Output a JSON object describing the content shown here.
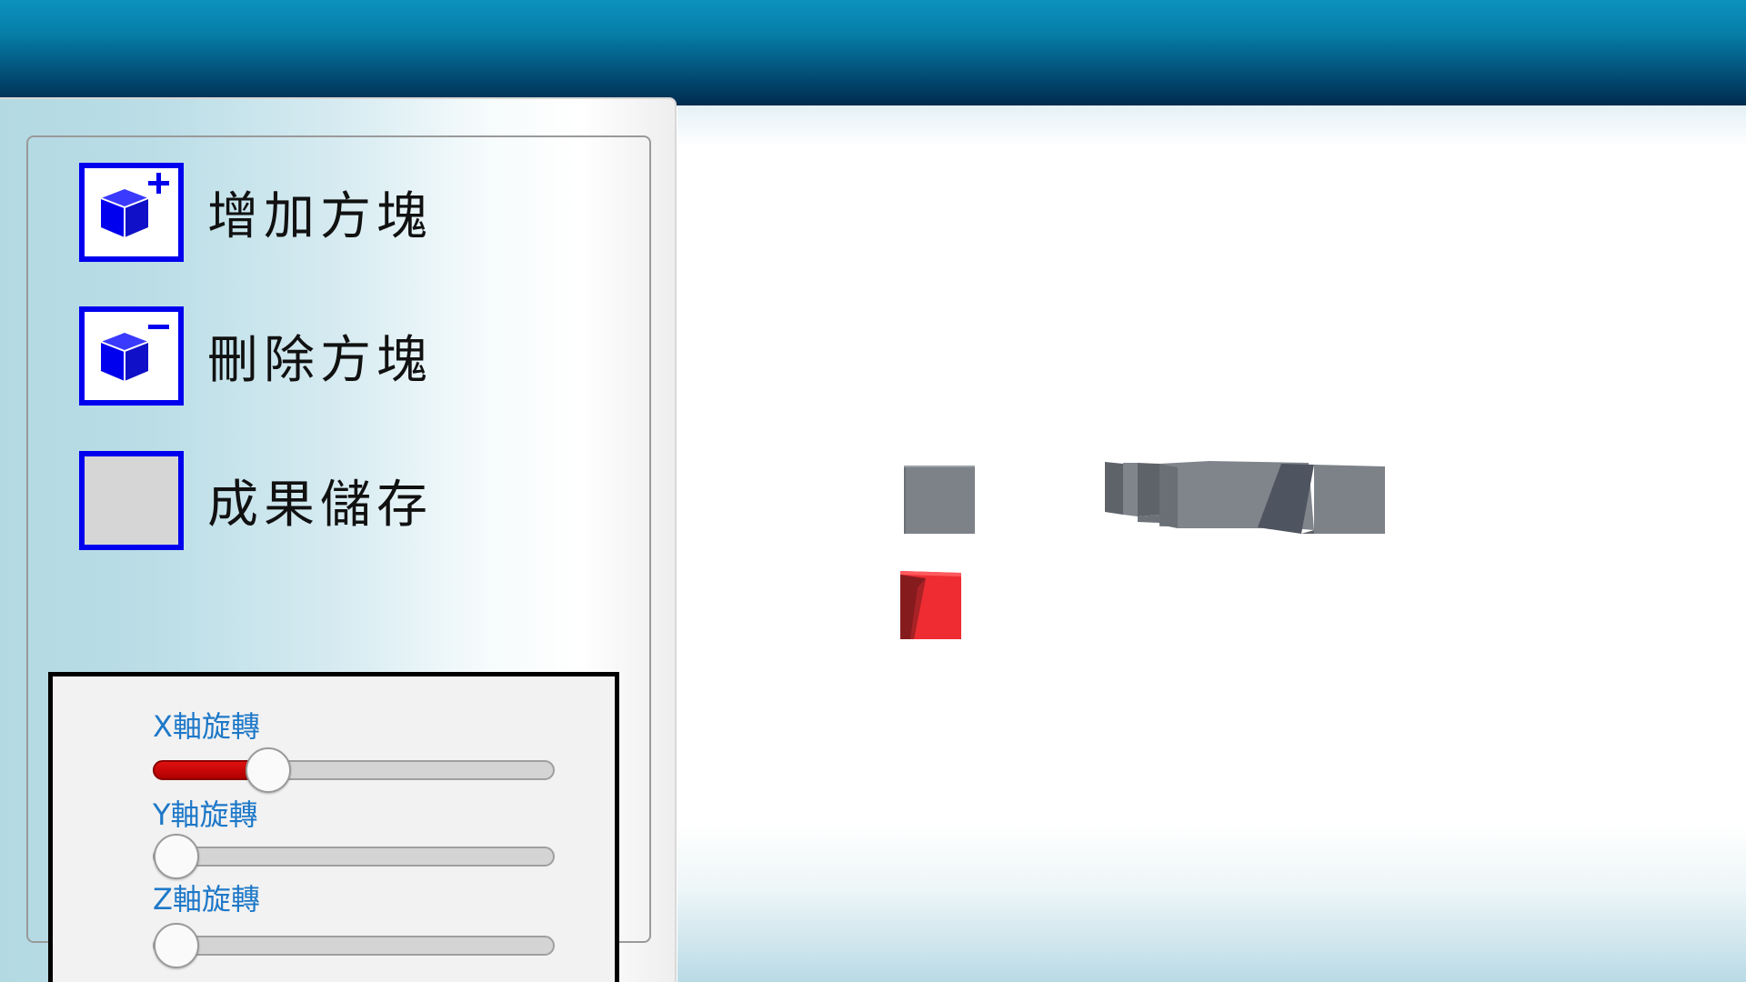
{
  "colors": {
    "header_top": "#0a92bd",
    "header_bottom": "#012b4e",
    "tool_border": "#0000ee",
    "slider_label": "#1e78c8",
    "slider_fill": "#cc0000",
    "selected_block": "#ee2c32",
    "block_gray": "#7d8289"
  },
  "tools": [
    {
      "label": "增加方塊",
      "icon": "add-cube-icon"
    },
    {
      "label": "刪除方塊",
      "icon": "remove-cube-icon"
    },
    {
      "label": "成果儲存",
      "icon": "save-blank-icon"
    }
  ],
  "rotation": {
    "x": {
      "label": "X軸旋轉",
      "value": 0.26
    },
    "y": {
      "label": "Y軸旋轉",
      "value": 0.0
    },
    "z": {
      "label": "Z軸旋轉",
      "value": 0.0
    }
  },
  "scene": {
    "blocks": [
      {
        "name": "gray-block-1",
        "color": "gray"
      },
      {
        "name": "gray-block-group",
        "color": "gray"
      },
      {
        "name": "selected-red-block",
        "color": "red"
      }
    ]
  }
}
